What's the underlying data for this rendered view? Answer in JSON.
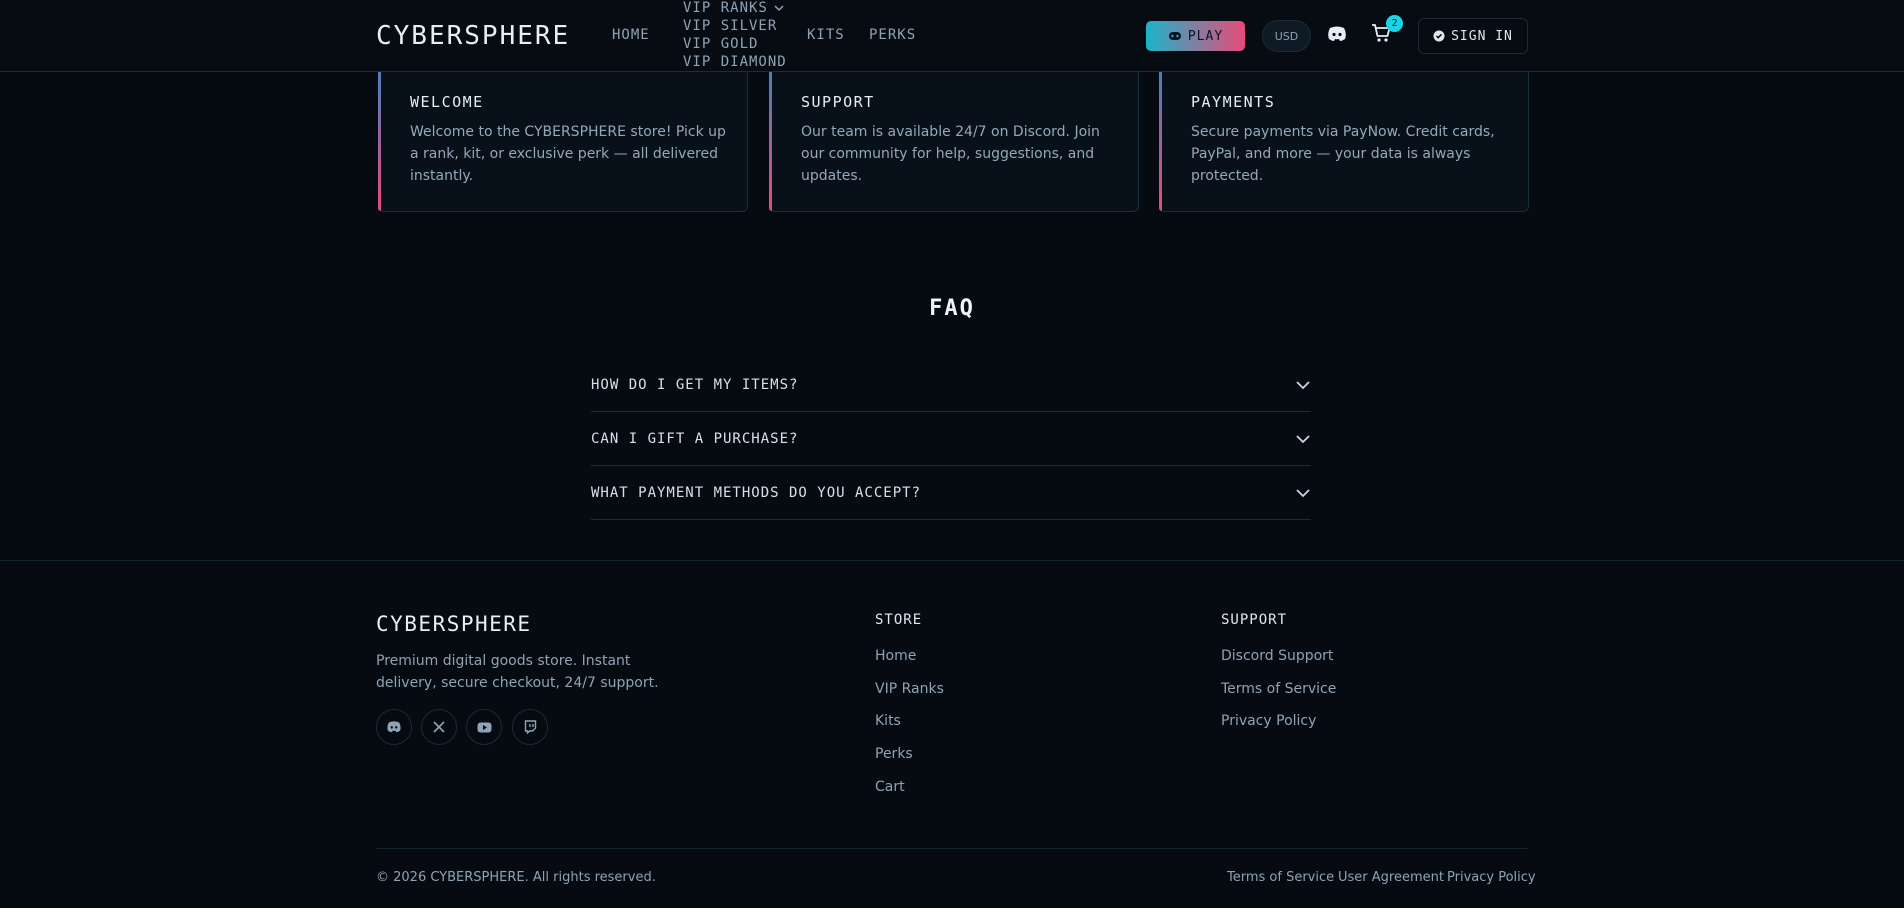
{
  "header": {
    "logo": "CYBERSPHERE",
    "nav": {
      "home": "HOME",
      "vip_ranks": "VIP RANKS",
      "vip_items": [
        "VIP SILVER",
        "VIP GOLD",
        "VIP DIAMOND"
      ],
      "kits": "KITS",
      "perks": "PERKS"
    },
    "play_label": "PLAY",
    "currency": "USD",
    "cart_count": "2",
    "signin_label": "SIGN IN"
  },
  "cards": [
    {
      "title": "WELCOME",
      "text": "Welcome to the CYBERSPHERE store! Pick up a rank, kit, or exclusive perk — all delivered instantly."
    },
    {
      "title": "SUPPORT",
      "text": "Our team is available 24/7 on Discord. Join our community for help, suggestions, and updates."
    },
    {
      "title": "PAYMENTS",
      "text": "Secure payments via PayNow. Credit cards, PayPal, and more — your data is always protected."
    }
  ],
  "faq": {
    "title": "FAQ",
    "items": [
      "HOW DO I GET MY ITEMS?",
      "CAN I GIFT A PURCHASE?",
      "WHAT PAYMENT METHODS DO YOU ACCEPT?"
    ]
  },
  "footer": {
    "logo": "CYBERSPHERE",
    "description": "Premium digital goods store. Instant delivery, secure checkout, 24/7 support.",
    "socials": [
      "discord-icon",
      "x-icon",
      "youtube-icon",
      "twitch-icon"
    ],
    "store": {
      "title": "STORE",
      "links": [
        "Home",
        "VIP Ranks",
        "Kits",
        "Perks",
        "Cart"
      ]
    },
    "support": {
      "title": "SUPPORT",
      "links": [
        "Discord Support",
        "Terms of Service",
        "Privacy Policy"
      ]
    },
    "copyright": "© 2026 CYBERSPHERE. All rights reserved.",
    "bottom_links": [
      "Terms of Service",
      "User Agreement",
      "Privacy Policy"
    ]
  },
  "colors": {
    "accent_cyan": "#1bb4c8",
    "accent_pink": "#e84a7a",
    "background": "#060b12"
  }
}
